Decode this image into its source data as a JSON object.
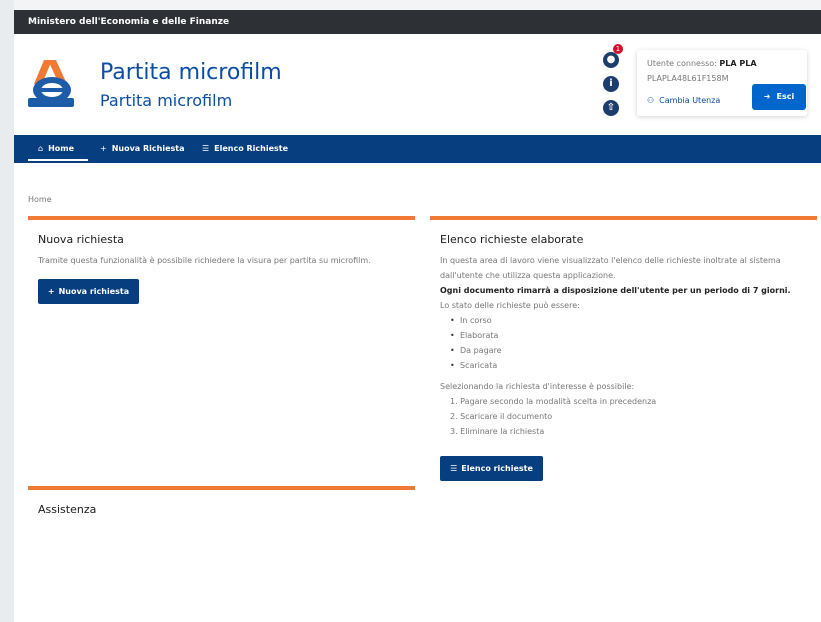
{
  "ministry_bar": {
    "label": "Ministero dell'Economia e delle Finanze"
  },
  "header": {
    "title": "Partita microfilm",
    "subtitle": "Partita microfilm",
    "notification_count": "1",
    "icons": [
      "bell-icon",
      "info-icon",
      "upload-icon"
    ]
  },
  "user": {
    "connected_label": "Utente connesso:",
    "connected_name": "PLA PLA",
    "code": "PLAPLA48L61F158M",
    "change_user_label": "Cambia Utenza",
    "exit_label": "Esci"
  },
  "nav": {
    "home": "Home",
    "new_request": "Nuova Richiesta",
    "request_list": "Elenco Richieste"
  },
  "breadcrumb": "Home",
  "new_request_card": {
    "title": "Nuova richiesta",
    "text": "Tramite questa funzionalità è possibile richiedere la visura per partita su microfilm.",
    "button_label": "Nuova richiesta"
  },
  "request_list_card": {
    "title": "Elenco richieste elaborate",
    "intro": "In questa area di lavoro viene visualizzato l'elenco delle richieste inoltrate al sistema dall'utente che utilizza questa applicazione.",
    "notice": "Ogni documento rimarrà a disposizione dell'utente per un periodo di 7 giorni.",
    "states_label": "Lo stato delle richieste può essere:",
    "states": [
      "In corso",
      "Elaborata",
      "Da pagare",
      "Scaricata"
    ],
    "actions_label": "Selezionando la richiesta d'interesse è possibile:",
    "actions": [
      "1. Pagare secondo la modalità scelta in precedenza",
      "2. Scaricare il documento",
      "3. Eliminare la richiesta"
    ],
    "button_label": "Elenco richieste"
  },
  "assistance_card": {
    "title": "Assistenza"
  },
  "colors": {
    "primary": "#073e7f",
    "accent": "#f07a34",
    "exit_button": "#0066cc"
  }
}
